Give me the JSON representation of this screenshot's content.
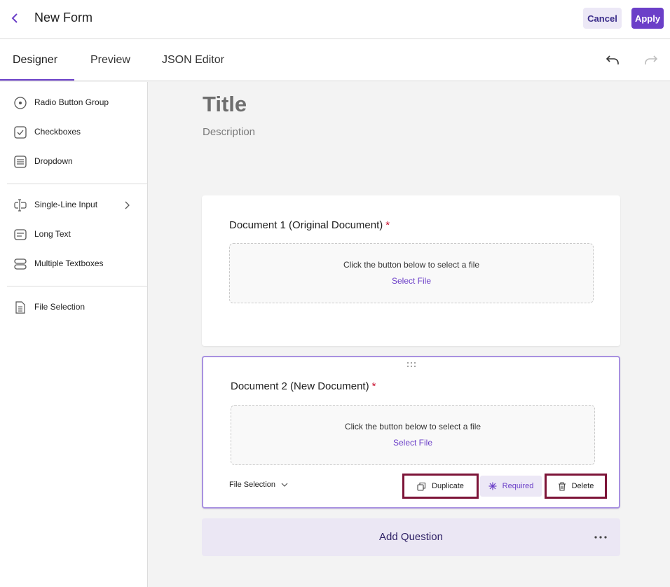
{
  "header": {
    "title": "New Form",
    "cancel_label": "Cancel",
    "apply_label": "Apply"
  },
  "tabs": [
    {
      "label": "Designer",
      "active": true
    },
    {
      "label": "Preview",
      "active": false
    },
    {
      "label": "JSON Editor",
      "active": false
    }
  ],
  "sidebar": {
    "items": [
      {
        "label": "Radio Button Group",
        "icon": "radio-icon"
      },
      {
        "label": "Checkboxes",
        "icon": "checkbox-icon"
      },
      {
        "label": "Dropdown",
        "icon": "dropdown-icon"
      },
      {
        "label": "Single-Line Input",
        "icon": "text-cursor-icon"
      },
      {
        "label": "Long Text",
        "icon": "long-text-icon"
      },
      {
        "label": "Multiple Textboxes",
        "icon": "multi-textbox-icon"
      },
      {
        "label": "File Selection",
        "icon": "file-icon"
      }
    ]
  },
  "form": {
    "title": "Title",
    "description": "Description"
  },
  "questions": [
    {
      "title": "Document 1 (Original Document)",
      "required_mark": "*",
      "dropzone_text": "Click the button below to select a file",
      "select_label": "Select File"
    },
    {
      "title": "Document 2 (New Document)",
      "required_mark": "*",
      "dropzone_text": "Click the button below to select a file",
      "select_label": "Select File",
      "type_label": "File Selection",
      "duplicate_label": "Duplicate",
      "required_label": "Required",
      "delete_label": "Delete"
    }
  ],
  "add_question_label": "Add Question",
  "colors": {
    "accent": "#6b3fc8",
    "accent_light": "#ece8f6",
    "highlight_border": "#7d1438",
    "required": "#c8102e"
  }
}
